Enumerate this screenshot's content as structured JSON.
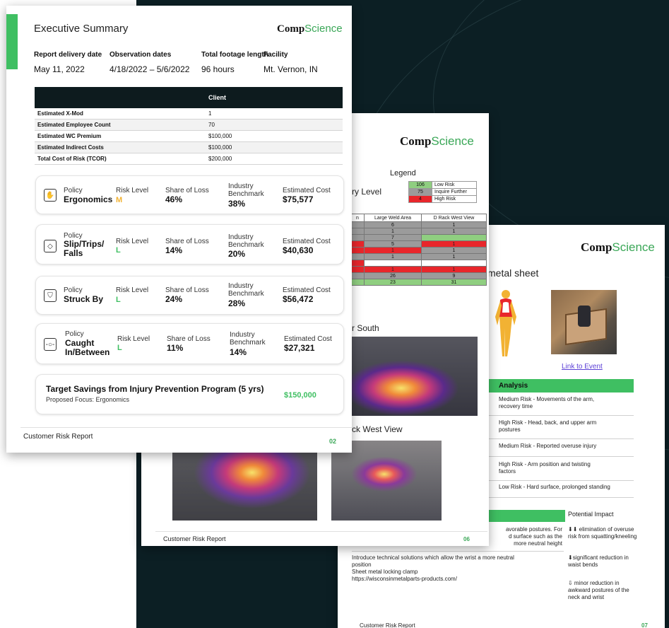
{
  "page1": {
    "title": "Executive Summary",
    "logo_comp": "Comp",
    "logo_science": "Science",
    "meta_labels": [
      "Report delivery date",
      "Observation dates",
      "Total footage length",
      "Facility"
    ],
    "meta_values": [
      "May 11, 2022",
      "4/18/2022 – 5/6/2022",
      "96 hours",
      "Mt. Vernon, IN"
    ],
    "table_header": "Client",
    "table_rows": [
      {
        "label": "Estimated X-Mod",
        "value": "1"
      },
      {
        "label": "Estimated Employee Count",
        "value": "70"
      },
      {
        "label": "Estimated WC Premium",
        "value": "$100,000"
      },
      {
        "label": "Estimated Indirect Costs",
        "value": "$100,000"
      },
      {
        "label": "Total Cost of Risk (TCOR)",
        "value": "$200,000"
      }
    ],
    "labels": {
      "policy": "Policy",
      "risk_level": "Risk Level",
      "share_of_loss": "Share of Loss",
      "industry_benchmark": "Industry\nBenchmark",
      "estimated_cost": "Estimated Cost"
    },
    "policies": [
      {
        "name": "Ergonomics",
        "risk": "M",
        "risk_color": "#f2b233",
        "share": "46%",
        "benchmark": "38%",
        "cost": "$75,577"
      },
      {
        "name": "Slip/Trips/\nFalls",
        "risk": "L",
        "risk_color": "#3fbf62",
        "share": "14%",
        "benchmark": "20%",
        "cost": "$40,630"
      },
      {
        "name": "Struck By",
        "risk": "L",
        "risk_color": "#3fbf62",
        "share": "24%",
        "benchmark": "28%",
        "cost": "$56,472"
      },
      {
        "name": "Caught\nIn/Between",
        "risk": "L",
        "risk_color": "#3fbf62",
        "share": "11%",
        "benchmark": "14%",
        "cost": "$27,321"
      }
    ],
    "target_title": "Target Savings from Injury Prevention Program (5 yrs)",
    "target_sub": "Proposed Focus: Ergonomics",
    "target_value": "$150,000",
    "footer": "Customer Risk Report",
    "page_num": "02",
    "accent": "#3fbf62"
  },
  "page2": {
    "logo_comp": "Comp",
    "logo_science": "Science",
    "legend_title": "Legend",
    "level_label": "ry Level",
    "legend": [
      {
        "count": "106",
        "label": "Low Risk",
        "color": "#8fce80"
      },
      {
        "count": "75",
        "label": "Inquire Further",
        "color": "#9b9b9b"
      },
      {
        "count": "4",
        "label": "High Risk",
        "color": "#e8262b"
      }
    ],
    "grid_headers": [
      "n",
      "Large Weld Area",
      "D Rack West View"
    ],
    "grid_rows": [
      [
        "6",
        "1"
      ],
      [
        "1",
        "1"
      ],
      [
        "7",
        ""
      ],
      [
        "5",
        "1"
      ],
      [
        "1",
        "1"
      ],
      [
        "1",
        "1"
      ],
      [
        "",
        ""
      ],
      [
        "1",
        "1"
      ],
      [
        "26",
        "9"
      ],
      [
        "23",
        "31"
      ]
    ],
    "caption_south": "r South",
    "caption_west": "ck West View",
    "footer": "Customer Risk Report",
    "page_num": "06"
  },
  "page3": {
    "logo_comp": "Comp",
    "logo_science": "Science",
    "heading": "metal sheet",
    "link": "Link to Event",
    "analysis_header": "Analysis",
    "analysis": [
      "Medium Risk - Movements of the arm,\nrecovery time",
      "High Risk - Head, back, and upper arm\npostures",
      "Medium Risk - Reported overuse injury",
      "High Risk - Arm position and twisting\nfactors",
      "Low Risk - Hard surface, prolonged standing"
    ],
    "potential_impact": "Potential Impact",
    "rec1": "avorable postures. For\nd surface such as the\nmore neutral height",
    "impact1": "⬇⬇ elimination of overuse\nrisk from squatting/kneeling",
    "rec2": "Introduce technical solutions which allow the wrist a more neutral\nposition\nSheet metal locking clamp\nhttps://wisconsinmetalparts-products.com/",
    "impact2": "⬇significant reduction in\nwaist bends",
    "impact3": "⇩ minor reduction in\nawkward postures of the\nneck and wrist",
    "footer": "Customer Risk Report",
    "page_num": "07"
  }
}
